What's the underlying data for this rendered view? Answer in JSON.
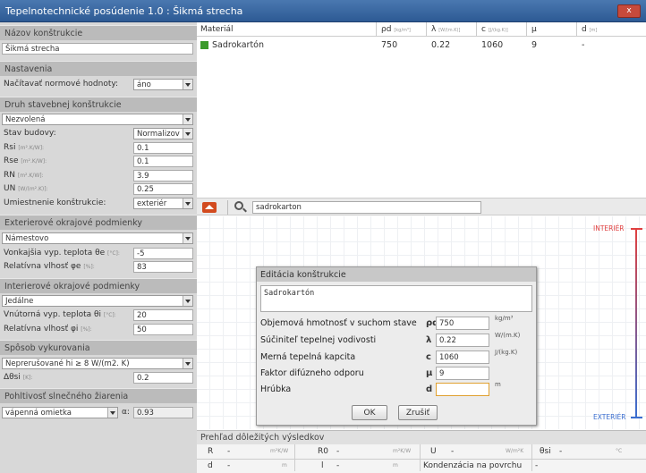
{
  "window": {
    "title": "Tepelnotechnické posúdenie 1.0 : Šikmá strecha",
    "close": "x"
  },
  "left": {
    "nazov": {
      "header": "Názov konštrukcie",
      "value": "Šikmá strecha"
    },
    "nastavenia": {
      "header": "Nastavenia",
      "label": "Načítavať normové hodnoty:",
      "value": "áno"
    },
    "druh": {
      "header": "Druh stavebnej konštrukcie",
      "select": "Nezvolená",
      "stav_label": "Stav budovy:",
      "stav_value": "Normalizov",
      "rows": [
        {
          "label": "Rsi",
          "unit": "[m².K/W]:",
          "value": "0.1"
        },
        {
          "label": "Rse",
          "unit": "[m².K/W]:",
          "value": "0.1"
        },
        {
          "label": "RN",
          "unit": "[m².K/W]:",
          "value": "3.9"
        },
        {
          "label": "UN",
          "unit": "[W/(m².K)]:",
          "value": "0.25"
        }
      ],
      "umiestnenie_label": "Umiestnenie konštrukcie:",
      "umiestnenie_value": "exteriér"
    },
    "exter": {
      "header": "Exterierové okrajové podmienky",
      "select": "Námestovo",
      "teplota_label": "Vonkajšia vyp. teplota θe",
      "teplota_unit": "[°C]:",
      "teplota_value": "-5",
      "vlhkost_label": "Relatívna vlhosť φe",
      "vlhkost_unit": "[%]:",
      "vlhkost_value": "83"
    },
    "inter": {
      "header": "Interierové okrajové podmienky",
      "select": "Jedálne",
      "teplota_label": "Vnútorná vyp. teplota θi",
      "teplota_unit": "[°C]:",
      "teplota_value": "20",
      "vlhkost_label": "Relatívna vlhosť φi",
      "vlhkost_unit": "[%]:",
      "vlhkost_value": "50"
    },
    "vykur": {
      "header": "Spôsob vykurovania",
      "select": "Neprerušované hi ≥ 8 W/(m2. K)",
      "dt_label": "Δθsi",
      "dt_unit": "[K]:",
      "dt_value": "0.2"
    },
    "pohlt": {
      "header": "Pohltivosť slnečného žiarenia",
      "select": "vápenná omietka",
      "a_label": "α:",
      "a_value": "0.93"
    }
  },
  "table": {
    "headers": [
      {
        "label": "Materiál",
        "unit": ""
      },
      {
        "label": "ρd",
        "unit": "[kg/m³]"
      },
      {
        "label": "λ",
        "unit": "[W/(m.K)]"
      },
      {
        "label": "c",
        "unit": "[J/(kg.K)]"
      },
      {
        "label": "μ",
        "unit": ""
      },
      {
        "label": "d",
        "unit": "[m]"
      }
    ],
    "rows": [
      {
        "name": "Sadrokartón",
        "rho": "750",
        "lambda": "0.22",
        "c": "1060",
        "mu": "9",
        "d": "-"
      }
    ]
  },
  "search": {
    "value": "sadrokarton"
  },
  "canvas": {
    "interior": "INTERIÉR",
    "exterior": "EXTERIÉR"
  },
  "dialog": {
    "title": "Editácia konštrukcie",
    "name": "Sadrokartón",
    "fields": [
      {
        "label": "Objemová hmotnosť v suchom stave",
        "sym": "ρd",
        "value": "750",
        "unit": "kg/m³"
      },
      {
        "label": "Súčiniteľ tepelnej vodivosti",
        "sym": "λ",
        "value": "0.22",
        "unit": "W/(m.K)"
      },
      {
        "label": "Merná tepelná kapcita",
        "sym": "c",
        "value": "1060",
        "unit": "J/(kg.K)"
      },
      {
        "label": "Faktor difúzneho odporu",
        "sym": "μ",
        "value": "9",
        "unit": ""
      },
      {
        "label": "Hrúbka",
        "sym": "d",
        "value": "",
        "unit": "m"
      }
    ],
    "ok": "OK",
    "cancel": "Zrušiť"
  },
  "summary": {
    "header": "Prehľad dôležitých výsledkov",
    "r1": [
      {
        "k": "R",
        "v": "-",
        "u": "m²K/W"
      },
      {
        "k": "R0",
        "v": "-",
        "u": "m²K/W"
      },
      {
        "k": "U",
        "v": "-",
        "u": "W/m²K"
      },
      {
        "k": "θsi",
        "v": "-",
        "u": "°C"
      }
    ],
    "r2": [
      {
        "k": "d",
        "v": "-",
        "u": "m"
      },
      {
        "k": "l",
        "v": "-",
        "u": "m"
      },
      {
        "k": "Kondenzácia na povrchu",
        "v": "-"
      }
    ]
  }
}
